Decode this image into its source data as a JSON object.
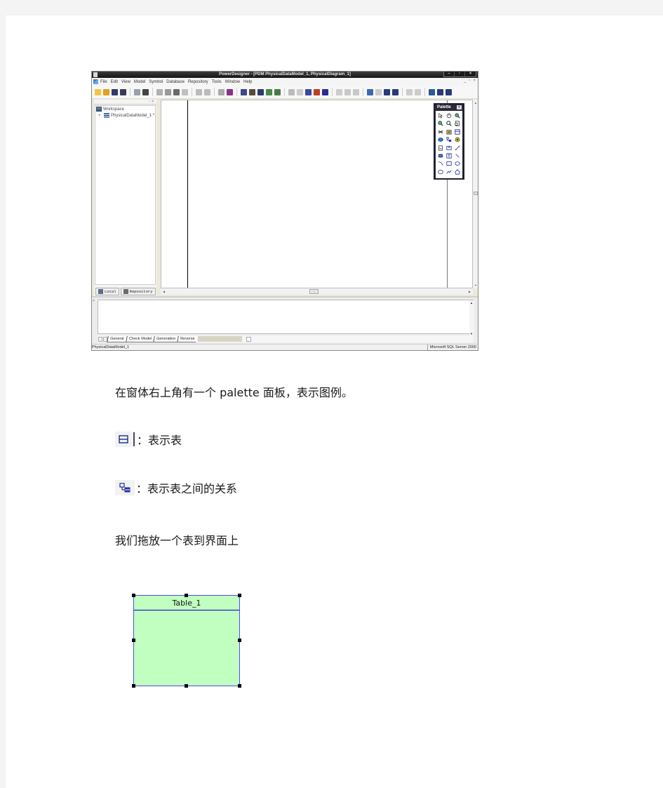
{
  "app": {
    "title": "PowerDesigner - [PDM PhysicalDataModel_1, PhysicalDiagram_1]",
    "window_controls": [
      "minimize",
      "restore",
      "close"
    ],
    "menu": [
      "File",
      "Edit",
      "View",
      "Model",
      "Symbol",
      "Database",
      "Repository",
      "Tools",
      "Window",
      "Help"
    ],
    "mdi_controls": [
      "_",
      "restore",
      "x"
    ],
    "toolbar_groups": [
      [
        "new-icon",
        "open-icon",
        "save-icon",
        "save-all-icon"
      ],
      [
        "print-preview-icon",
        "print-icon"
      ],
      [
        "cut-icon",
        "copy-icon",
        "paste-icon",
        "delete-icon"
      ],
      [
        "undo-icon",
        "redo-icon"
      ],
      [
        "properties-icon",
        "model-icon"
      ],
      [
        "edit-icon",
        "check-model-icon",
        "generate-icon",
        "validate-icon",
        "check-icon"
      ],
      [
        "shape-icon",
        "grid-icon",
        "pen-icon",
        "fill-icon",
        "font-icon"
      ],
      [
        "image-icon",
        "back-icon",
        "forward-icon"
      ],
      [
        "browser-toggle-icon",
        "layout-icon",
        "panel-a-icon",
        "panel-b-icon"
      ],
      [
        "align-left-icon",
        "align-right-icon"
      ],
      [
        "window-a-icon",
        "window-b-icon",
        "window-c-icon"
      ]
    ],
    "browser": {
      "tree": [
        {
          "label": "Workspace",
          "icon": "workspace-icon",
          "expander": ""
        },
        {
          "label": "PhysicalDataModel_1 *",
          "icon": "model-icon",
          "expander": "+"
        }
      ],
      "tabs": [
        "Local",
        "Repository"
      ]
    },
    "palette": {
      "title": "Palette",
      "close": "x",
      "tools": [
        "pointer-icon",
        "grabber-icon",
        "zoom-in-icon",
        "zoom-out-icon",
        "open-view-icon",
        "properties-icon",
        "delete-icon",
        "package-icon",
        "table-icon",
        "view-icon",
        "reference-icon",
        "procedure-icon",
        "file-icon",
        "view-reference-icon",
        "link-icon",
        "title-icon",
        "text-icon",
        "line-icon",
        "arc-icon",
        "rectangle-icon",
        "ellipse-icon",
        "rounded-rect-icon",
        "polyline-icon",
        "polygon-icon"
      ]
    },
    "output": {
      "tabs": [
        "General",
        "Check Model",
        "Generation",
        "Reverse"
      ]
    },
    "status": {
      "left": "PhysicalDataModel_1",
      "right": "Microsoft SQL Server 2000"
    }
  },
  "document": {
    "p1": "在窗体右上角有一个 palette 面板，表示图例。",
    "legend": [
      {
        "icon": "table-icon",
        "text": "：表示表"
      },
      {
        "icon": "reference-icon",
        "text": "：表示表之间的关系"
      }
    ],
    "p2": "我们拖放一个表到界面上"
  },
  "entity": {
    "name": "Table_1",
    "fill": "#c0ffc0",
    "border": "#4c4cff"
  }
}
